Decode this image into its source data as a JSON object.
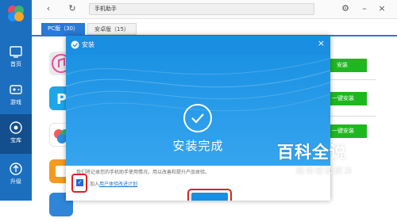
{
  "colors": {
    "sidebar": "#1c6fbf",
    "accent": "#2979d6",
    "dialog_header": "#1a8ee0",
    "install_green": "#1fb71f",
    "highlight_red": "#e02020"
  },
  "sidebar": {
    "items": [
      {
        "label": "首页",
        "icon": "home-icon"
      },
      {
        "label": "游戏",
        "icon": "gamepad-icon"
      },
      {
        "label": "宝库",
        "icon": "disc-icon"
      },
      {
        "label": "升级",
        "icon": "upgrade-icon"
      }
    ]
  },
  "topbar": {
    "address": "手机助手"
  },
  "tabs": [
    {
      "label": "PC版（30）"
    },
    {
      "label": "安卓版（15）"
    }
  ],
  "list": {
    "install_label": "安装",
    "one_click_label": "一键安装"
  },
  "dialog": {
    "title": "安装",
    "status": "安装完成",
    "note": "我们将记录您的手机助手使用情况，用以改善和提升产品体验。",
    "join_prefix": "加入",
    "join_link": "用户体验改进计划",
    "checkbox_checked": true
  },
  "watermark": {
    "line1": "百科全说",
    "line2": "助你轻松解决"
  }
}
